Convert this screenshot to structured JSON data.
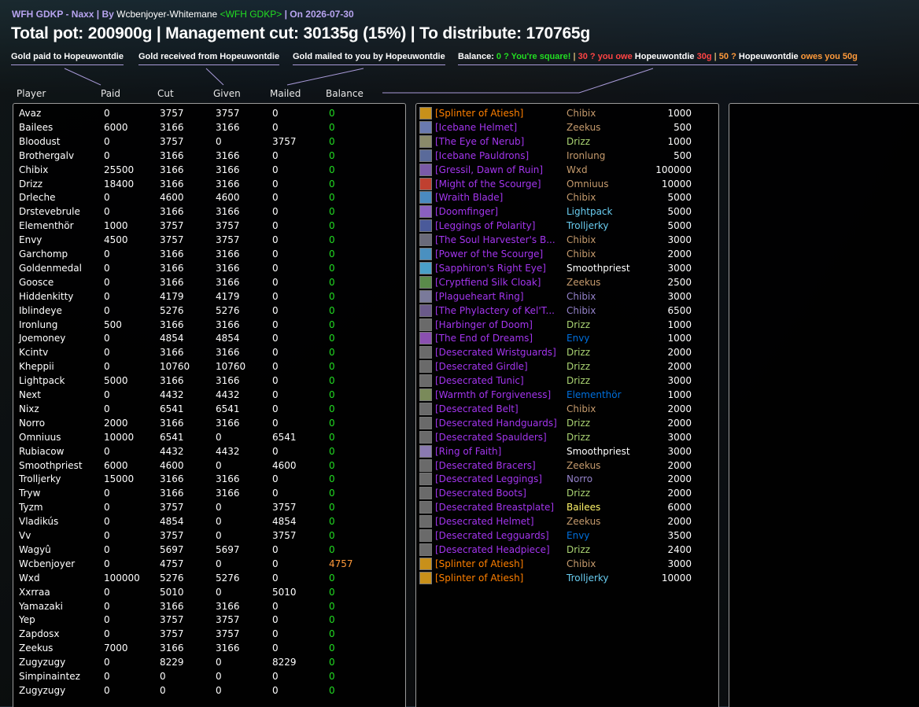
{
  "header": {
    "addon": "WFH GDKP - Naxx",
    "by_label": " | By ",
    "author": "Wcbenjoyer-Whitemane",
    "guild": "<WFH GDKP>",
    "date_text": " | On 2026-07-30"
  },
  "totals": "Total pot: 200900g | Management cut: 30135g (15%) | To distribute: 170765g",
  "legend": {
    "paid": "Gold paid to Hopeuwontdie",
    "received": "Gold received from Hopeuwontdie",
    "mailed": "Gold mailed to you by Hopeuwontdie",
    "balance_label": "Balance:",
    "square": "0 ? You're square!",
    "sep": "|",
    "owe_prefix": "30 ? you owe",
    "owe_name": "Hopeuwontdie",
    "owe_amount": "30g",
    "owed_prefix": "50 ?",
    "owed_name": "Hopeuwontdie",
    "owed_suffix": "owes you 50g"
  },
  "columns": [
    "Player",
    "Paid",
    "Cut",
    "Given",
    "Mailed",
    "Balance"
  ],
  "players": [
    {
      "name": "Avaz",
      "paid": "0",
      "cut": "3757",
      "given": "3757",
      "mailed": "0",
      "balance": "0"
    },
    {
      "name": "Bailees",
      "paid": "6000",
      "cut": "3166",
      "given": "3166",
      "mailed": "0",
      "balance": "0"
    },
    {
      "name": "Bloodust",
      "paid": "0",
      "cut": "3757",
      "given": "0",
      "mailed": "3757",
      "balance": "0"
    },
    {
      "name": "Brothergalv",
      "paid": "0",
      "cut": "3166",
      "given": "3166",
      "mailed": "0",
      "balance": "0"
    },
    {
      "name": "Chibix",
      "paid": "25500",
      "cut": "3166",
      "given": "3166",
      "mailed": "0",
      "balance": "0"
    },
    {
      "name": "Drizz",
      "paid": "18400",
      "cut": "3166",
      "given": "3166",
      "mailed": "0",
      "balance": "0"
    },
    {
      "name": "Drleche",
      "paid": "0",
      "cut": "4600",
      "given": "4600",
      "mailed": "0",
      "balance": "0"
    },
    {
      "name": "Drstevebrule",
      "paid": "0",
      "cut": "3166",
      "given": "3166",
      "mailed": "0",
      "balance": "0"
    },
    {
      "name": "Elementhör",
      "paid": "1000",
      "cut": "3757",
      "given": "3757",
      "mailed": "0",
      "balance": "0"
    },
    {
      "name": "Envy",
      "paid": "4500",
      "cut": "3757",
      "given": "3757",
      "mailed": "0",
      "balance": "0"
    },
    {
      "name": "Garchomp",
      "paid": "0",
      "cut": "3166",
      "given": "3166",
      "mailed": "0",
      "balance": "0"
    },
    {
      "name": "Goldenmedal",
      "paid": "0",
      "cut": "3166",
      "given": "3166",
      "mailed": "0",
      "balance": "0"
    },
    {
      "name": "Goosce",
      "paid": "0",
      "cut": "3166",
      "given": "3166",
      "mailed": "0",
      "balance": "0"
    },
    {
      "name": "Hiddenkitty",
      "paid": "0",
      "cut": "4179",
      "given": "4179",
      "mailed": "0",
      "balance": "0"
    },
    {
      "name": "Iblindeye",
      "paid": "0",
      "cut": "5276",
      "given": "5276",
      "mailed": "0",
      "balance": "0"
    },
    {
      "name": "Ironlung",
      "paid": "500",
      "cut": "3166",
      "given": "3166",
      "mailed": "0",
      "balance": "0"
    },
    {
      "name": "Joemoney",
      "paid": "0",
      "cut": "4854",
      "given": "4854",
      "mailed": "0",
      "balance": "0"
    },
    {
      "name": "Kcintv",
      "paid": "0",
      "cut": "3166",
      "given": "3166",
      "mailed": "0",
      "balance": "0"
    },
    {
      "name": "Kheppii",
      "paid": "0",
      "cut": "10760",
      "given": "10760",
      "mailed": "0",
      "balance": "0"
    },
    {
      "name": "Lightpack",
      "paid": "5000",
      "cut": "3166",
      "given": "3166",
      "mailed": "0",
      "balance": "0"
    },
    {
      "name": "Next",
      "paid": "0",
      "cut": "4432",
      "given": "4432",
      "mailed": "0",
      "balance": "0"
    },
    {
      "name": "Nixz",
      "paid": "0",
      "cut": "6541",
      "given": "6541",
      "mailed": "0",
      "balance": "0"
    },
    {
      "name": "Norro",
      "paid": "2000",
      "cut": "3166",
      "given": "3166",
      "mailed": "0",
      "balance": "0"
    },
    {
      "name": "Omniuus",
      "paid": "10000",
      "cut": "6541",
      "given": "0",
      "mailed": "6541",
      "balance": "0"
    },
    {
      "name": "Rubiacow",
      "paid": "0",
      "cut": "4432",
      "given": "4432",
      "mailed": "0",
      "balance": "0"
    },
    {
      "name": "Smoothpriest",
      "paid": "6000",
      "cut": "4600",
      "given": "0",
      "mailed": "4600",
      "balance": "0"
    },
    {
      "name": "Trolljerky",
      "paid": "15000",
      "cut": "3166",
      "given": "3166",
      "mailed": "0",
      "balance": "0"
    },
    {
      "name": "Tryw",
      "paid": "0",
      "cut": "3166",
      "given": "3166",
      "mailed": "0",
      "balance": "0"
    },
    {
      "name": "Tyzm",
      "paid": "0",
      "cut": "3757",
      "given": "0",
      "mailed": "3757",
      "balance": "0"
    },
    {
      "name": "Vladikús",
      "paid": "0",
      "cut": "4854",
      "given": "0",
      "mailed": "4854",
      "balance": "0"
    },
    {
      "name": "Vv",
      "paid": "0",
      "cut": "3757",
      "given": "0",
      "mailed": "3757",
      "balance": "0"
    },
    {
      "name": "Wagyû",
      "paid": "0",
      "cut": "5697",
      "given": "5697",
      "mailed": "0",
      "balance": "0"
    },
    {
      "name": "Wcbenjoyer",
      "paid": "0",
      "cut": "4757",
      "given": "0",
      "mailed": "0",
      "balance": "4757"
    },
    {
      "name": "Wxd",
      "paid": "100000",
      "cut": "5276",
      "given": "5276",
      "mailed": "0",
      "balance": "0"
    },
    {
      "name": "Xxrraa",
      "paid": "0",
      "cut": "5010",
      "given": "0",
      "mailed": "5010",
      "balance": "0"
    },
    {
      "name": "Yamazaki",
      "paid": "0",
      "cut": "3166",
      "given": "3166",
      "mailed": "0",
      "balance": "0"
    },
    {
      "name": "Yep",
      "paid": "0",
      "cut": "3757",
      "given": "3757",
      "mailed": "0",
      "balance": "0"
    },
    {
      "name": "Zapdosx",
      "paid": "0",
      "cut": "3757",
      "given": "3757",
      "mailed": "0",
      "balance": "0"
    },
    {
      "name": "Zeekus",
      "paid": "7000",
      "cut": "3166",
      "given": "3166",
      "mailed": "0",
      "balance": "0"
    },
    {
      "name": "Zugyzugy",
      "paid": "0",
      "cut": "8229",
      "given": "0",
      "mailed": "8229",
      "balance": "0"
    },
    {
      "name": "Simpinaintez",
      "paid": "0",
      "cut": "0",
      "given": "0",
      "mailed": "0",
      "balance": "0"
    },
    {
      "name": "Zugyzugy",
      "paid": "0",
      "cut": "0",
      "given": "0",
      "mailed": "0",
      "balance": "0"
    }
  ],
  "items": [
    {
      "item": "[Splinter of Atiesh]",
      "rarity": "legendary",
      "icon_color": "#c8901a",
      "buyer": "Chibix",
      "class_color": "#c69b6d",
      "price": "1000"
    },
    {
      "item": "[Icebane Helmet]",
      "rarity": "epic",
      "icon_color": "#6a7ab0",
      "buyer": "Zeekus",
      "class_color": "#c69b6d",
      "price": "500"
    },
    {
      "item": "[The Eye of Nerub]",
      "rarity": "epic",
      "icon_color": "#8a8a6a",
      "buyer": "Drizz",
      "class_color": "#abd473",
      "price": "1000"
    },
    {
      "item": "[Icebane Pauldrons]",
      "rarity": "epic",
      "icon_color": "#5a6a9a",
      "buyer": "Ironlung",
      "class_color": "#c69b6d",
      "price": "500"
    },
    {
      "item": "[Gressil, Dawn of Ruin]",
      "rarity": "epic",
      "icon_color": "#7a5aa8",
      "buyer": "Wxd",
      "class_color": "#c69b6d",
      "price": "100000"
    },
    {
      "item": "[Might of the Scourge]",
      "rarity": "epic",
      "icon_color": "#c04030",
      "buyer": "Omniuus",
      "class_color": "#c69b6d",
      "price": "10000"
    },
    {
      "item": "[Wraith Blade]",
      "rarity": "epic",
      "icon_color": "#4a8ac0",
      "buyer": "Chibix",
      "class_color": "#c69b6d",
      "price": "5000"
    },
    {
      "item": "[Doomfinger]",
      "rarity": "epic",
      "icon_color": "#8a60c0",
      "buyer": "Lightpack",
      "class_color": "#69ccf0",
      "price": "5000"
    },
    {
      "item": "[Leggings of Polarity]",
      "rarity": "epic",
      "icon_color": "#4a5a9a",
      "buyer": "Trolljerky",
      "class_color": "#69ccf0",
      "price": "5000"
    },
    {
      "item": "[The Soul Harvester's B...",
      "rarity": "epic",
      "icon_color": "#6a6a7a",
      "buyer": "Chibix",
      "class_color": "#c69b6d",
      "price": "3000"
    },
    {
      "item": "[Power of the Scourge]",
      "rarity": "epic",
      "icon_color": "#4a90c0",
      "buyer": "Chibix",
      "class_color": "#c69b6d",
      "price": "2000"
    },
    {
      "item": "[Sapphiron's Right Eye]",
      "rarity": "epic",
      "icon_color": "#4aa0c8",
      "buyer": "Smoothpriest",
      "class_color": "#ffffff",
      "price": "3000"
    },
    {
      "item": "[Cryptfiend Silk Cloak]",
      "rarity": "epic",
      "icon_color": "#5a8a4a",
      "buyer": "Zeekus",
      "class_color": "#c69b6d",
      "price": "2500"
    },
    {
      "item": "[Plagueheart Ring]",
      "rarity": "epic",
      "icon_color": "#7a7a9a",
      "buyer": "Chibix",
      "class_color": "#9482c9",
      "price": "3000"
    },
    {
      "item": "[The Phylactery of Kel'T...",
      "rarity": "epic",
      "icon_color": "#6a5a8a",
      "buyer": "Chibix",
      "class_color": "#9482c9",
      "price": "6500"
    },
    {
      "item": "[Harbinger of Doom]",
      "rarity": "epic",
      "icon_color": "#6a6a6a",
      "buyer": "Drizz",
      "class_color": "#abd473",
      "price": "1000"
    },
    {
      "item": "[The End of Dreams]",
      "rarity": "epic",
      "icon_color": "#8a50b0",
      "buyer": "Envy",
      "class_color": "#0070de",
      "price": "1000"
    },
    {
      "item": "[Desecrated Wristguards]",
      "rarity": "epic",
      "icon_color": "#6a6a6a",
      "buyer": "Drizz",
      "class_color": "#abd473",
      "price": "2000"
    },
    {
      "item": "[Desecrated Girdle]",
      "rarity": "epic",
      "icon_color": "#6a6a6a",
      "buyer": "Drizz",
      "class_color": "#abd473",
      "price": "2000"
    },
    {
      "item": "[Desecrated Tunic]",
      "rarity": "epic",
      "icon_color": "#6a6a6a",
      "buyer": "Drizz",
      "class_color": "#abd473",
      "price": "3000"
    },
    {
      "item": "[Warmth of Forgiveness]",
      "rarity": "epic",
      "icon_color": "#7a8a5a",
      "buyer": "Elementhör",
      "class_color": "#0070de",
      "price": "1000"
    },
    {
      "item": "[Desecrated Belt]",
      "rarity": "epic",
      "icon_color": "#6a6a6a",
      "buyer": "Chibix",
      "class_color": "#c69b6d",
      "price": "2000"
    },
    {
      "item": "[Desecrated Handguards]",
      "rarity": "epic",
      "icon_color": "#6a6a6a",
      "buyer": "Drizz",
      "class_color": "#abd473",
      "price": "2000"
    },
    {
      "item": "[Desecrated Spaulders]",
      "rarity": "epic",
      "icon_color": "#6a6a6a",
      "buyer": "Drizz",
      "class_color": "#abd473",
      "price": "3000"
    },
    {
      "item": "[Ring of Faith]",
      "rarity": "epic",
      "icon_color": "#8a7ab0",
      "buyer": "Smoothpriest",
      "class_color": "#ffffff",
      "price": "3000"
    },
    {
      "item": "[Desecrated Bracers]",
      "rarity": "epic",
      "icon_color": "#6a6a6a",
      "buyer": "Zeekus",
      "class_color": "#c69b6d",
      "price": "2000"
    },
    {
      "item": "[Desecrated Leggings]",
      "rarity": "epic",
      "icon_color": "#6a6a6a",
      "buyer": "Norro",
      "class_color": "#9482c9",
      "price": "2000"
    },
    {
      "item": "[Desecrated Boots]",
      "rarity": "epic",
      "icon_color": "#6a6a6a",
      "buyer": "Drizz",
      "class_color": "#abd473",
      "price": "2000"
    },
    {
      "item": "[Desecrated Breastplate]",
      "rarity": "epic",
      "icon_color": "#6a6a6a",
      "buyer": "Bailees",
      "class_color": "#fff569",
      "price": "6000"
    },
    {
      "item": "[Desecrated Helmet]",
      "rarity": "epic",
      "icon_color": "#6a6a6a",
      "buyer": "Zeekus",
      "class_color": "#c69b6d",
      "price": "2000"
    },
    {
      "item": "[Desecrated Legguards]",
      "rarity": "epic",
      "icon_color": "#6a6a6a",
      "buyer": "Envy",
      "class_color": "#0070de",
      "price": "3500"
    },
    {
      "item": "[Desecrated Headpiece]",
      "rarity": "epic",
      "icon_color": "#6a6a6a",
      "buyer": "Drizz",
      "class_color": "#abd473",
      "price": "2400"
    },
    {
      "item": "[Splinter of Atiesh]",
      "rarity": "legendary",
      "icon_color": "#c8901a",
      "buyer": "Chibix",
      "class_color": "#c69b6d",
      "price": "3000"
    },
    {
      "item": "[Splinter of Atiesh]",
      "rarity": "legendary",
      "icon_color": "#c8901a",
      "buyer": "Trolljerky",
      "class_color": "#69ccf0",
      "price": "10000"
    }
  ]
}
